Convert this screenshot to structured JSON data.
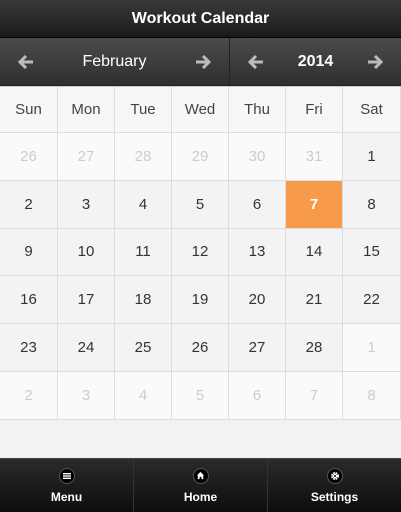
{
  "header": {
    "title": "Workout Calendar"
  },
  "navigation": {
    "month": "February",
    "year": "2014"
  },
  "calendar": {
    "weekdays": [
      "Sun",
      "Mon",
      "Tue",
      "Wed",
      "Thu",
      "Fri",
      "Sat"
    ],
    "weeks": [
      [
        "26",
        "27",
        "28",
        "29",
        "30",
        "31",
        "1"
      ],
      [
        "2",
        "3",
        "4",
        "5",
        "6",
        "7",
        "8"
      ],
      [
        "9",
        "10",
        "11",
        "12",
        "13",
        "14",
        "15"
      ],
      [
        "16",
        "17",
        "18",
        "19",
        "20",
        "21",
        "22"
      ],
      [
        "23",
        "24",
        "25",
        "26",
        "27",
        "28",
        "1"
      ],
      [
        "2",
        "3",
        "4",
        "5",
        "6",
        "7",
        "8"
      ]
    ],
    "today_color": "#f79a49"
  },
  "tabbar": {
    "items": [
      {
        "label": "Menu",
        "icon": "menu-icon"
      },
      {
        "label": "Home",
        "icon": "home-icon"
      },
      {
        "label": "Settings",
        "icon": "gear-icon"
      }
    ]
  }
}
